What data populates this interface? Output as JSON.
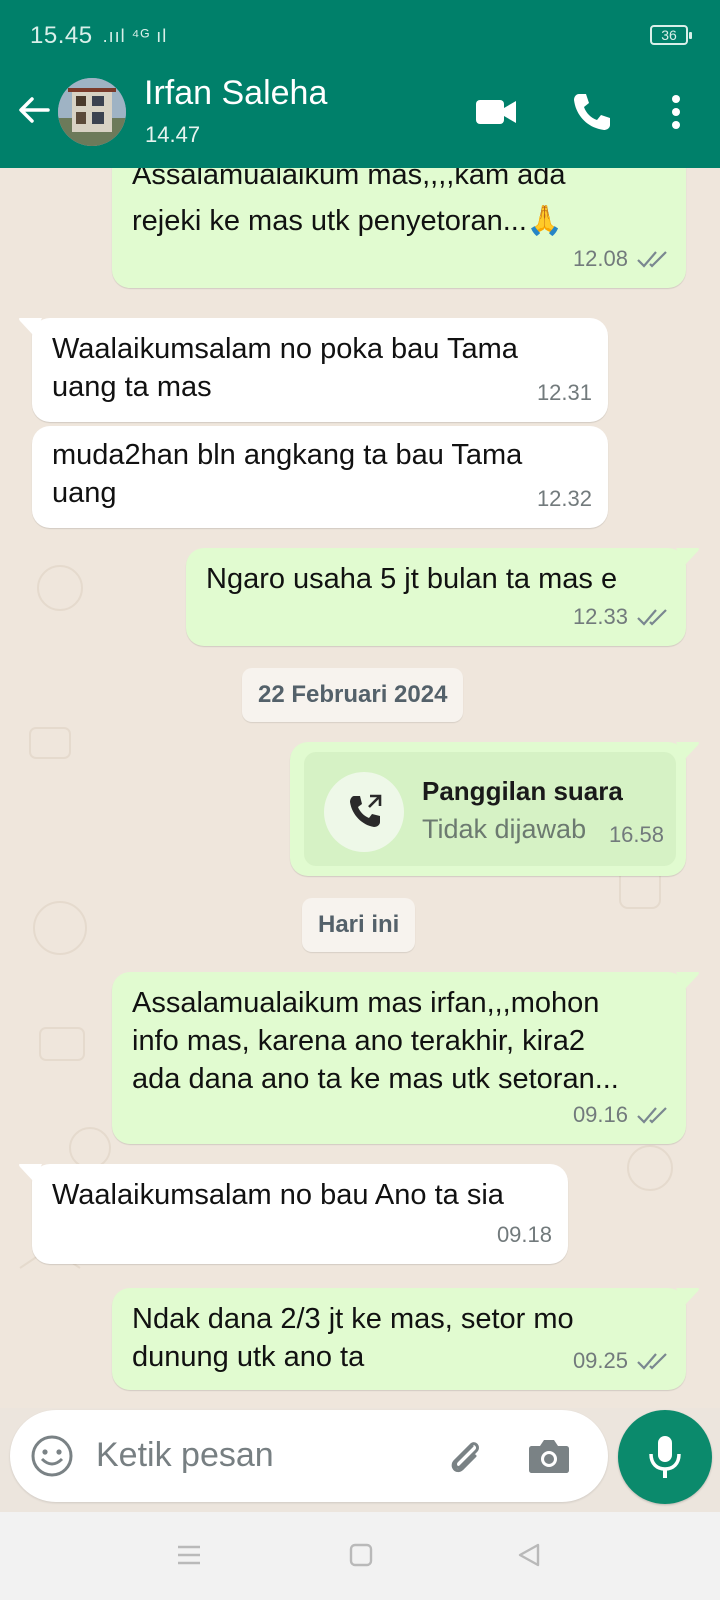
{
  "status": {
    "time": "15.45",
    "signal": ".ııl ⁴ᴳ ıl",
    "battery": "36"
  },
  "header": {
    "name": "Irfan Saleha",
    "last_seen": "14.47"
  },
  "messages": [
    {
      "dir": "out",
      "line1": "Assalamualaikum mas,,,,kam ada",
      "line2": "rejeki ke mas utk penyetoran...🙏",
      "time": "12.08"
    },
    {
      "dir": "in",
      "line1": "Waalaikumsalam no poka bau Tama",
      "line2": "uang ta mas",
      "time": "12.31"
    },
    {
      "dir": "in",
      "line1": "muda2han bln angkang ta bau Tama",
      "line2": "uang",
      "time": "12.32"
    },
    {
      "dir": "out",
      "line1": "Ngaro usaha 5 jt  bulan ta mas e",
      "time": "12.33"
    },
    {
      "dir": "out",
      "line1": "Assalamualaikum mas irfan,,,mohon",
      "line2": "info mas, karena ano terakhir, kira2",
      "line3": "ada dana ano ta ke mas utk setoran...",
      "time": "09.16"
    },
    {
      "dir": "in",
      "line1": "Waalaikumsalam no bau Ano ta sia",
      "time": "09.18"
    },
    {
      "dir": "out",
      "line1": "Ndak dana 2/3 jt ke mas, setor mo",
      "line2": "dunung utk ano ta",
      "time": "09.25"
    }
  ],
  "dates": {
    "first": "22 Februari 2024",
    "second": "Hari ini"
  },
  "call": {
    "title": "Panggilan suara",
    "status": "Tidak dijawab",
    "time": "16.58"
  },
  "input": {
    "placeholder": "Ketik pesan"
  },
  "icons": [
    "back-arrow-icon",
    "video-call-icon",
    "phone-icon",
    "more-icon",
    "emoji-icon",
    "attach-icon",
    "camera-icon",
    "mic-icon",
    "double-check-icon"
  ],
  "colors": {
    "header": "#00806a",
    "outgoing": "#e1fbd0",
    "incoming": "#ffffff",
    "mic": "#0b8a6c"
  }
}
